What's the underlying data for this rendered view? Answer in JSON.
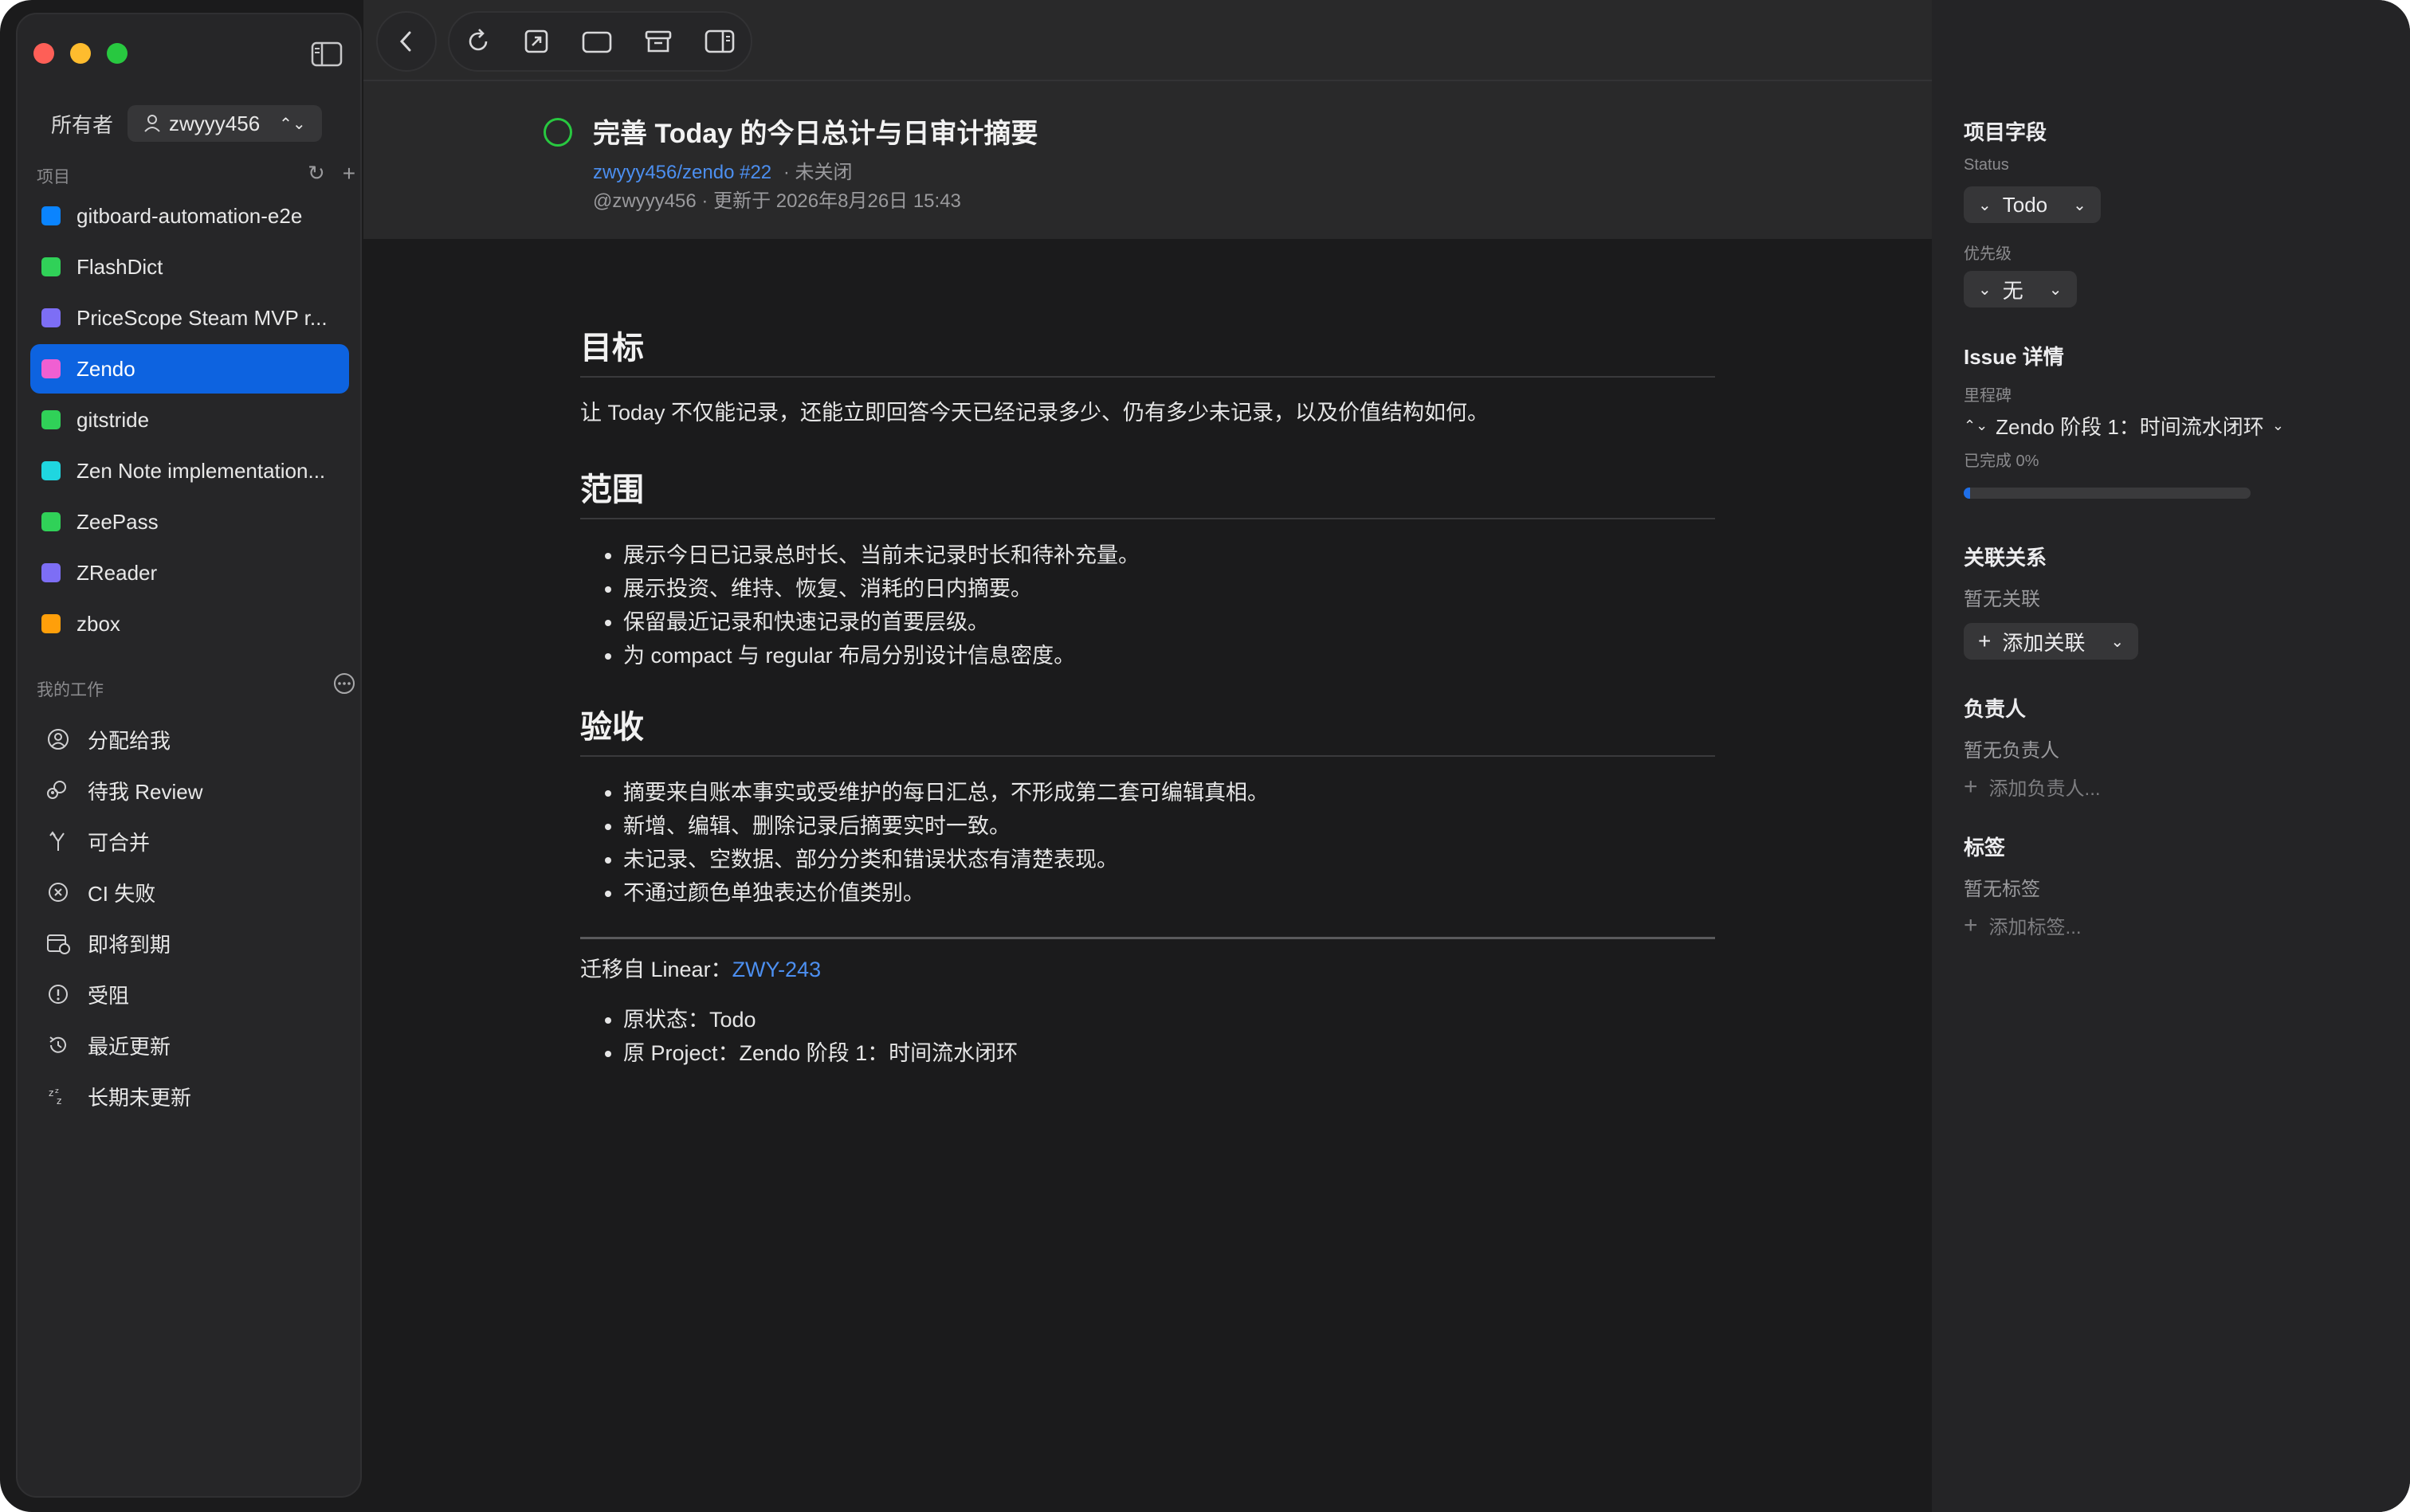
{
  "sidebar": {
    "owner_label": "所有者",
    "owner_value": "zwyyy456",
    "projects_heading": "项目",
    "projects": [
      {
        "label": "gitboard-automation-e2e",
        "color": "#0a84ff"
      },
      {
        "label": "FlashDict",
        "color": "#30d158"
      },
      {
        "label": "PriceScope Steam MVP r...",
        "color": "#7d6ef5"
      },
      {
        "label": "Zendo",
        "color": "#f05fd2"
      },
      {
        "label": "gitstride",
        "color": "#30d158"
      },
      {
        "label": "Zen Note implementation...",
        "color": "#1fd6e0"
      },
      {
        "label": "ZeePass",
        "color": "#30d158"
      },
      {
        "label": "ZReader",
        "color": "#7d6ef5"
      },
      {
        "label": "zbox",
        "color": "#ff9f0a"
      }
    ],
    "active_project_index": 3,
    "work_heading": "我的工作",
    "work_items": [
      {
        "label": "分配给我",
        "icon": "person-circle-icon"
      },
      {
        "label": "待我 Review",
        "icon": "people-review-icon"
      },
      {
        "label": "可合并",
        "icon": "merge-icon"
      },
      {
        "label": "CI 失败",
        "icon": "x-circle-icon"
      },
      {
        "label": "即将到期",
        "icon": "calendar-clock-icon"
      },
      {
        "label": "受阻",
        "icon": "exclamation-circle-icon"
      },
      {
        "label": "最近更新",
        "icon": "history-icon"
      },
      {
        "label": "长期未更新",
        "icon": "zzz-icon"
      }
    ]
  },
  "issue": {
    "title": "完善 Today 的今日总计与日审计摘要",
    "repo_link": "zwyyy456/zendo #22",
    "state": "· 未关闭",
    "meta": "@zwyyy456 · 更新于 2026年8月26日 15:43"
  },
  "body": {
    "goal_heading": "目标",
    "goal_text": "让 Today 不仅能记录，还能立即回答今天已经记录多少、仍有多少未记录，以及价值结构如何。",
    "scope_heading": "范围",
    "scope_items": [
      "展示今日已记录总时长、当前未记录时长和待补充量。",
      "展示投资、维持、恢复、消耗的日内摘要。",
      "保留最近记录和快速记录的首要层级。",
      "为 compact 与 regular 布局分别设计信息密度。"
    ],
    "accept_heading": "验收",
    "accept_items": [
      "摘要来自账本事实或受维护的每日汇总，不形成第二套可编辑真相。",
      "新增、编辑、删除记录后摘要实时一致。",
      "未记录、空数据、部分分类和错误状态有清楚表现。",
      "不通过颜色单独表达价值类别。"
    ],
    "migrated_prefix": "迁移自 Linear：",
    "migrated_link": "ZWY-243",
    "orig_items": [
      "原状态：Todo",
      "原 Project：Zendo 阶段 1：时间流水闭环"
    ]
  },
  "panel": {
    "fields_heading": "项目字段",
    "status_label": "Status",
    "status_value": "Todo",
    "priority_label": "优先级",
    "priority_value": "无",
    "details_heading": "Issue 详情",
    "milestone_label": "里程碑",
    "milestone_value": "Zendo 阶段 1：时间流水闭环",
    "completed_text": "已完成 0%",
    "completed_fraction": 0,
    "relations_heading": "关联关系",
    "relations_empty": "暂无关联",
    "add_relation": "添加关联",
    "assignee_heading": "负责人",
    "assignee_empty": "暂无负责人",
    "add_assignee": "添加负责人...",
    "labels_heading": "标签",
    "labels_empty": "暂无标签",
    "add_label": "添加标签..."
  }
}
